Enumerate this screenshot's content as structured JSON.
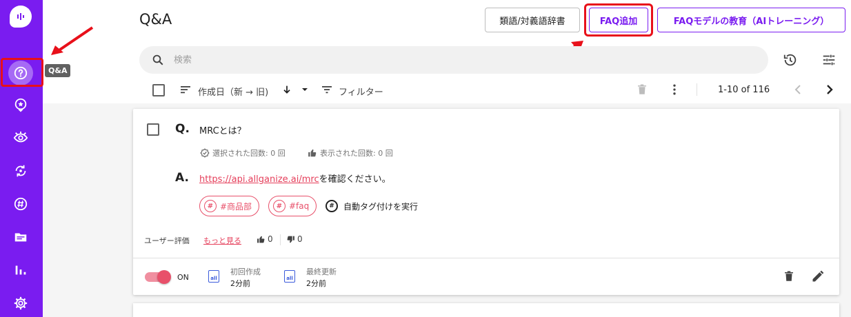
{
  "sidebar": {
    "tooltip": "Q&A"
  },
  "header": {
    "title": "Q&A",
    "dict_button": "類語/対義語辞書",
    "faq_add_button": "FAQ追加",
    "training_button": "FAQモデルの教育（AIトレーニング）"
  },
  "search": {
    "placeholder": "検索"
  },
  "toolbar": {
    "sort_label": "作成日（新 → 旧)",
    "filter_label": "フィルター",
    "pagination": "1-10 of 116"
  },
  "faq_item": {
    "q_mark": "Q.",
    "question": "MRCとは？",
    "selected_count": "選択された回数: 0 回",
    "displayed_count": "表示された回数: 0 回",
    "a_mark": "A.",
    "answer_link": "https://api.allganize.ai/mrc",
    "answer_suffix": "を確認ください。",
    "tags": [
      "#商品部",
      "#faq"
    ],
    "auto_tag_label": "自動タグ付けを実行",
    "rating_label": "ユーザー評価",
    "rating_more": "もっと見る",
    "likes": "0",
    "dislikes": "0",
    "toggle_label": "ON",
    "created_label": "初回作成",
    "created_value": "2分前",
    "updated_label": "最終更新",
    "updated_value": "2分前"
  },
  "colors": {
    "sidebar": "#7a1cf0",
    "accent": "#7a1cf0",
    "tag": "#e8506a",
    "annotation": "#e8101a"
  }
}
